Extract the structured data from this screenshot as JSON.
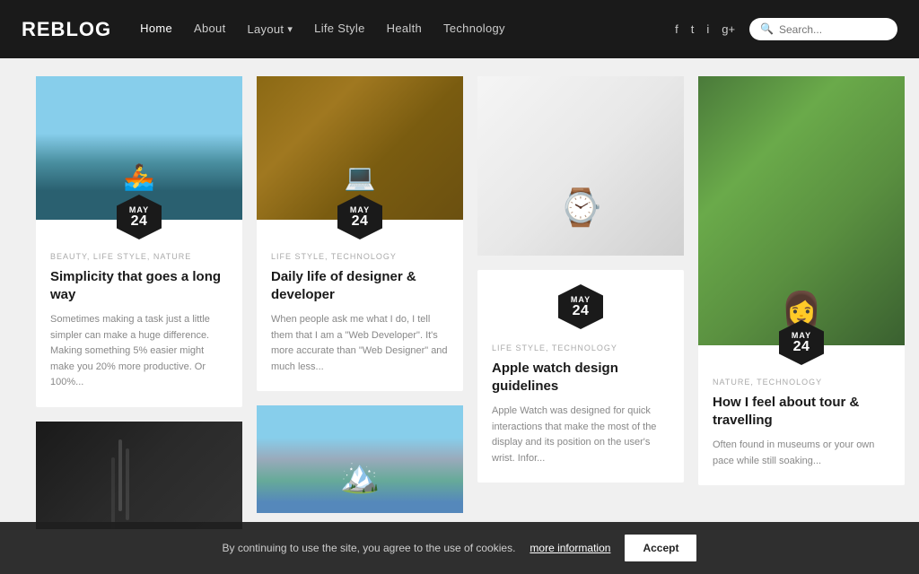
{
  "brand": "REBLOG",
  "nav": {
    "links": [
      {
        "label": "Home",
        "active": true,
        "has_dropdown": false
      },
      {
        "label": "About",
        "active": false,
        "has_dropdown": false
      },
      {
        "label": "Layout",
        "active": false,
        "has_dropdown": true
      },
      {
        "label": "Life Style",
        "active": false,
        "has_dropdown": false
      },
      {
        "label": "Health",
        "active": false,
        "has_dropdown": false
      },
      {
        "label": "Technology",
        "active": false,
        "has_dropdown": false
      }
    ],
    "social": [
      "f",
      "t",
      "i",
      "g+"
    ],
    "search_placeholder": "Search..."
  },
  "cards": [
    {
      "id": "card1",
      "month": "MAY",
      "day": "24",
      "tags": "BEAUTY, LIFE STYLE, NATURE",
      "title": "Simplicity that goes a long way",
      "excerpt": "Sometimes making a task just a little simpler can make a huge difference. Making something 5% easier might make you 20% more productive. Or 100%...",
      "img_type": "kayak"
    },
    {
      "id": "card2",
      "month": "MAY",
      "day": "24",
      "tags": "LIFE STYLE, TECHNOLOGY",
      "title": "Daily life of designer & developer",
      "excerpt": "When people ask me what I do, I tell them that I am a \"Web Developer\". It's more accurate than \"Web Designer\" and much less...",
      "img_type": "desk"
    },
    {
      "id": "card3",
      "month": "MAY",
      "day": "24",
      "tags": "LIFE STYLE, TECHNOLOGY",
      "title": "Apple watch design guidelines",
      "excerpt": "Apple Watch was designed for quick interactions that make the most of the display and its position on the user's wrist. Infor...",
      "img_type": "watch"
    },
    {
      "id": "card4",
      "month": "MAY",
      "day": "24",
      "tags": "NATURE, TECHNOLOGY",
      "title": "How I feel about tour & travelling",
      "excerpt": "Often found in museums or",
      "img_type": "girl",
      "tall": true
    }
  ],
  "bottom_cards": [
    {
      "id": "bcard1",
      "img_type": "smoke"
    },
    {
      "id": "bcard2",
      "img_type": "mountains"
    }
  ],
  "cookie": {
    "text": "By continuing to use the site, you agree to the use of cookies.",
    "link_text": "more information",
    "button_label": "Accept"
  }
}
